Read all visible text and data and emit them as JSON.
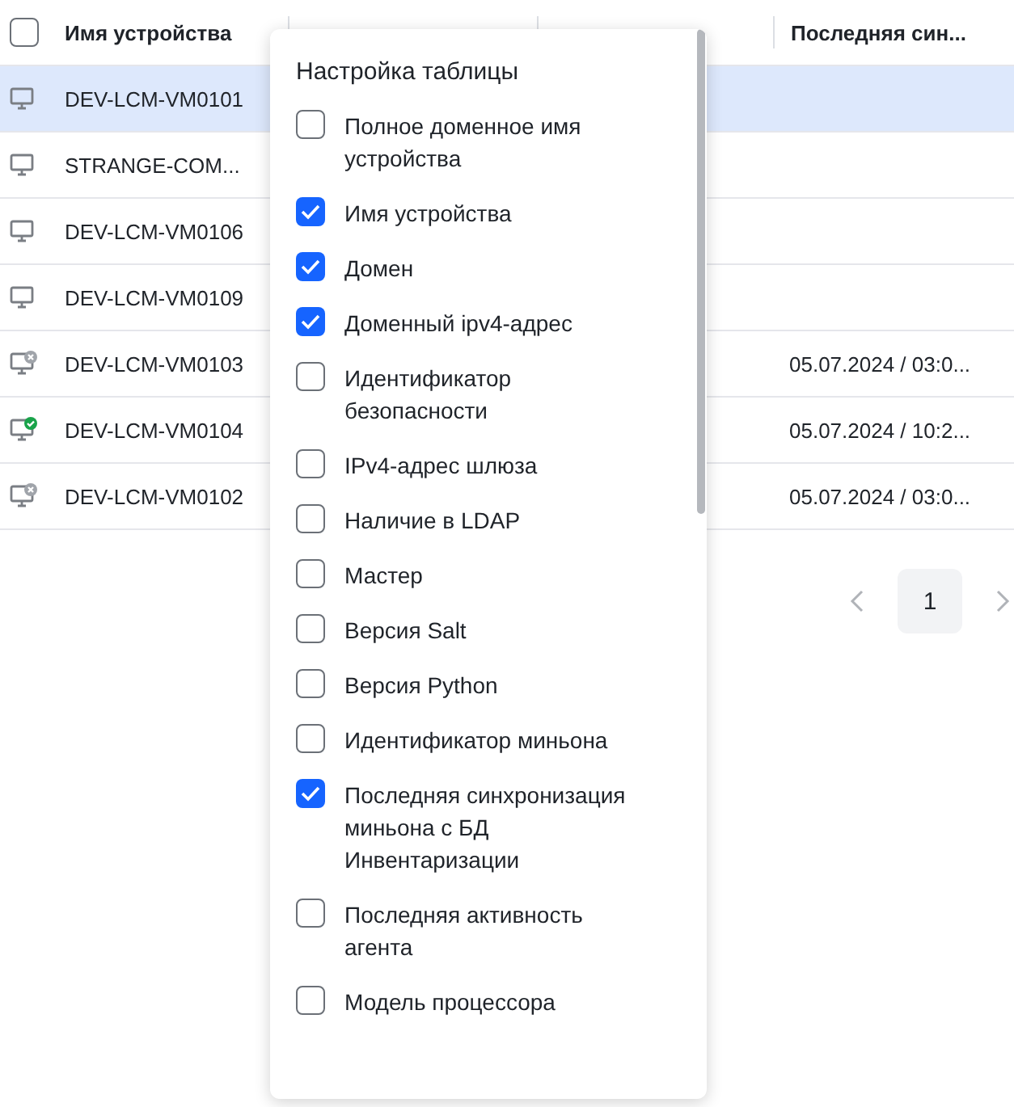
{
  "table": {
    "select_all": {
      "checked": false
    },
    "columns": [
      {
        "kind": "text",
        "label": "Имя устройства"
      },
      {
        "kind": "covered"
      },
      {
        "kind": "covered"
      },
      {
        "kind": "text",
        "label": "Последняя син..."
      }
    ],
    "rows": [
      {
        "name": "DEV-LCM-VM0101",
        "kind": "plain",
        "selected": true
      },
      {
        "name": "STRANGE-COM...",
        "kind": "plain",
        "selected": false
      },
      {
        "name": "DEV-LCM-VM0106",
        "kind": "plain",
        "selected": false
      },
      {
        "name": "DEV-LCM-VM0109",
        "kind": "plain",
        "selected": false
      },
      {
        "name": "DEV-LCM-VM0103",
        "kind": "offline",
        "selected": false,
        "sync": "05.07.2024 / 03:0..."
      },
      {
        "name": "DEV-LCM-VM0104",
        "kind": "online",
        "selected": false,
        "sync": "05.07.2024 / 10:2..."
      },
      {
        "name": "DEV-LCM-VM0102",
        "kind": "offline",
        "selected": false,
        "sync": "05.07.2024 / 03:0..."
      }
    ]
  },
  "pagination": {
    "pages": [
      {
        "label": "1",
        "selected": true
      }
    ]
  },
  "popup": {
    "title": "Настройка таблицы",
    "options": [
      {
        "label": "Полное доменное имя устройства",
        "checked": false
      },
      {
        "label": "Имя устройства",
        "checked": true
      },
      {
        "label": "Домен",
        "checked": true
      },
      {
        "label": "Доменный ipv4-адрес",
        "checked": true
      },
      {
        "label": "Идентификатор безопасности",
        "checked": false
      },
      {
        "label": "IPv4-адрес шлюза",
        "checked": false
      },
      {
        "label": "Наличие в LDAP",
        "checked": false
      },
      {
        "label": "Мастер",
        "checked": false
      },
      {
        "label": "Версия Salt",
        "checked": false
      },
      {
        "label": "Версия Python",
        "checked": false
      },
      {
        "label": "Идентификатор миньона",
        "checked": false
      },
      {
        "label": "Последняя синхронизация миньона с БД Инвентаризации",
        "checked": true
      },
      {
        "label": "Последняя активность агента",
        "checked": false
      },
      {
        "label": "Модель процессора",
        "checked": false
      }
    ]
  }
}
